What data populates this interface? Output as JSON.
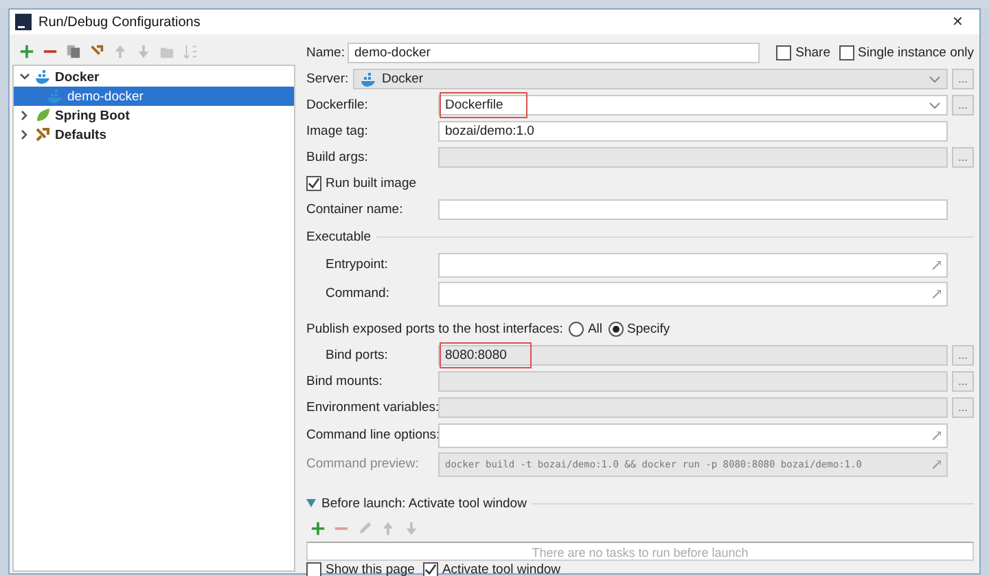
{
  "window": {
    "title": "Run/Debug Configurations",
    "close": "✕"
  },
  "toolbar": [
    {
      "kind": "add",
      "disabled": false
    },
    {
      "kind": "remove",
      "disabled": false
    },
    {
      "kind": "copy",
      "disabled": false
    },
    {
      "kind": "settings",
      "disabled": false
    },
    {
      "kind": "up",
      "disabled": true
    },
    {
      "kind": "down",
      "disabled": true
    },
    {
      "kind": "folder",
      "disabled": true
    },
    {
      "kind": "sort",
      "disabled": true
    }
  ],
  "tree": [
    {
      "label": "Docker",
      "kind": "docker",
      "expanded": true,
      "selected": false,
      "children": [
        {
          "label": "demo-docker",
          "kind": "docker",
          "selected": true
        }
      ]
    },
    {
      "label": "Spring Boot",
      "kind": "spring",
      "expanded": false,
      "selected": false
    },
    {
      "label": "Defaults",
      "kind": "defaults",
      "expanded": false,
      "selected": false
    }
  ],
  "name": {
    "label": "Name:",
    "value": "demo-docker"
  },
  "name_options": [
    {
      "label": "Share",
      "checked": false
    },
    {
      "label": "Single instance only",
      "checked": false
    }
  ],
  "form": [
    {
      "kind": "icon_combo",
      "label": "Server:",
      "value": "Docker",
      "browse": "..."
    },
    {
      "kind": "combo",
      "label": "Dockerfile:",
      "value": "Dockerfile",
      "browse": "...",
      "highlighted": true
    },
    {
      "kind": "text",
      "label": "Image tag:",
      "value": "bozai/demo:1.0"
    },
    {
      "kind": "text",
      "label": "Build args:",
      "disabled": true,
      "browse": "..."
    },
    {
      "kind": "checkbox",
      "label": "Run built image",
      "checked": true
    },
    {
      "kind": "text",
      "label": "Container name:"
    },
    {
      "kind": "section",
      "label": "Executable"
    },
    {
      "kind": "expandable",
      "label": "Entrypoint:",
      "indented": true
    },
    {
      "kind": "expandable",
      "label": "Command:",
      "indented": true
    },
    {
      "kind": "radio",
      "label": "Publish exposed ports to the host interfaces:",
      "options": [
        {
          "label": "All",
          "selected": false
        },
        {
          "label": "Specify",
          "selected": true
        }
      ]
    },
    {
      "kind": "text",
      "label": "Bind ports:",
      "value": "8080:8080",
      "disabled": true,
      "indented": true,
      "highlighted": true,
      "browse": "..."
    },
    {
      "kind": "text",
      "label": "Bind mounts:",
      "disabled": true,
      "browse": "..."
    },
    {
      "kind": "text",
      "label": "Environment variables:",
      "disabled": true,
      "browse": "..."
    },
    {
      "kind": "expandable",
      "label": "Command line options:"
    },
    {
      "kind": "preview",
      "label": "Command preview:",
      "value": "docker build -t bozai/demo:1.0  && docker run -p 8080:8080 bozai/demo:1.0",
      "disabled": true
    }
  ],
  "before_launch": {
    "title": "Before launch: Activate tool window",
    "expanded": true,
    "tools": [
      {
        "kind": "add",
        "disabled": false
      },
      {
        "kind": "remove",
        "disabled": true
      },
      {
        "kind": "edit",
        "disabled": true
      },
      {
        "kind": "up",
        "disabled": true
      },
      {
        "kind": "down",
        "disabled": true
      }
    ],
    "empty_text": "There are no tasks to run before launch"
  },
  "bottom_options": [
    {
      "label": "Show this page",
      "checked": false
    },
    {
      "label": "Activate tool window",
      "checked": true
    }
  ]
}
